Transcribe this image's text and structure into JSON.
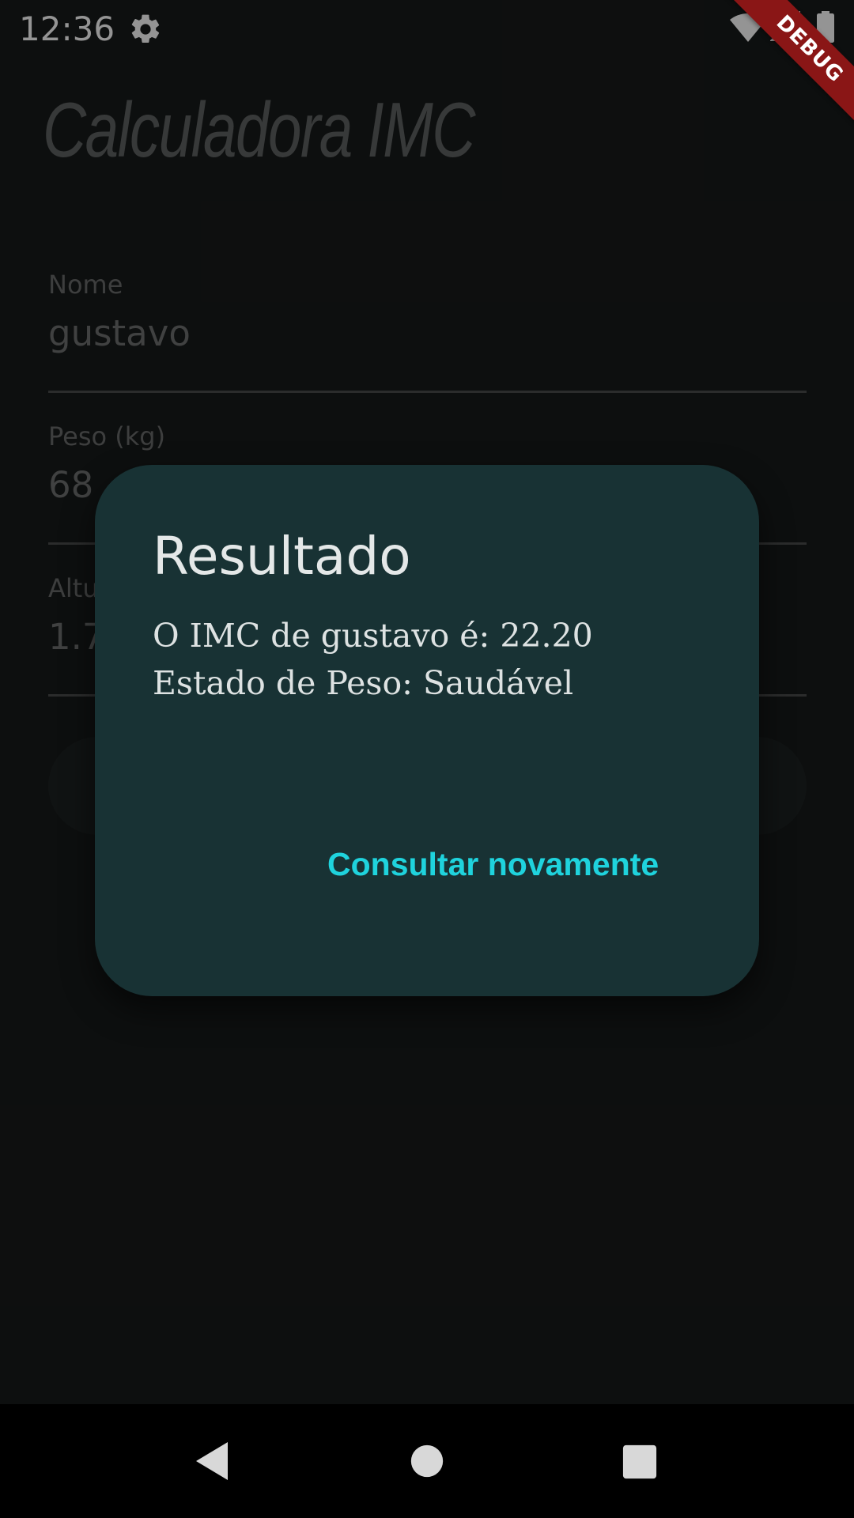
{
  "status_bar": {
    "time": "12:36",
    "icons": [
      "gear-icon",
      "wifi-icon",
      "cell-signal-icon",
      "battery-icon"
    ]
  },
  "debug_banner": {
    "label": "DEBUG"
  },
  "app": {
    "title": "Calculadora IMC",
    "fields": [
      {
        "label": "Nome",
        "value": "gustavo"
      },
      {
        "label": "Peso (kg)",
        "value": "68"
      },
      {
        "label": "Altu",
        "value": "1.7"
      }
    ]
  },
  "dialog": {
    "title": "Resultado",
    "body_lines": [
      "O IMC de gustavo é: 22.20",
      "Estado de Peso: Saudável"
    ],
    "action_label": "Consultar novamente"
  },
  "nav_bar": {
    "icons": [
      "back-icon",
      "home-icon",
      "recents-icon"
    ]
  },
  "colors": {
    "background": "#181a1a",
    "dialog_background": "#183234",
    "accent": "#1fd3dd",
    "debug_banner": "#8a1616"
  }
}
